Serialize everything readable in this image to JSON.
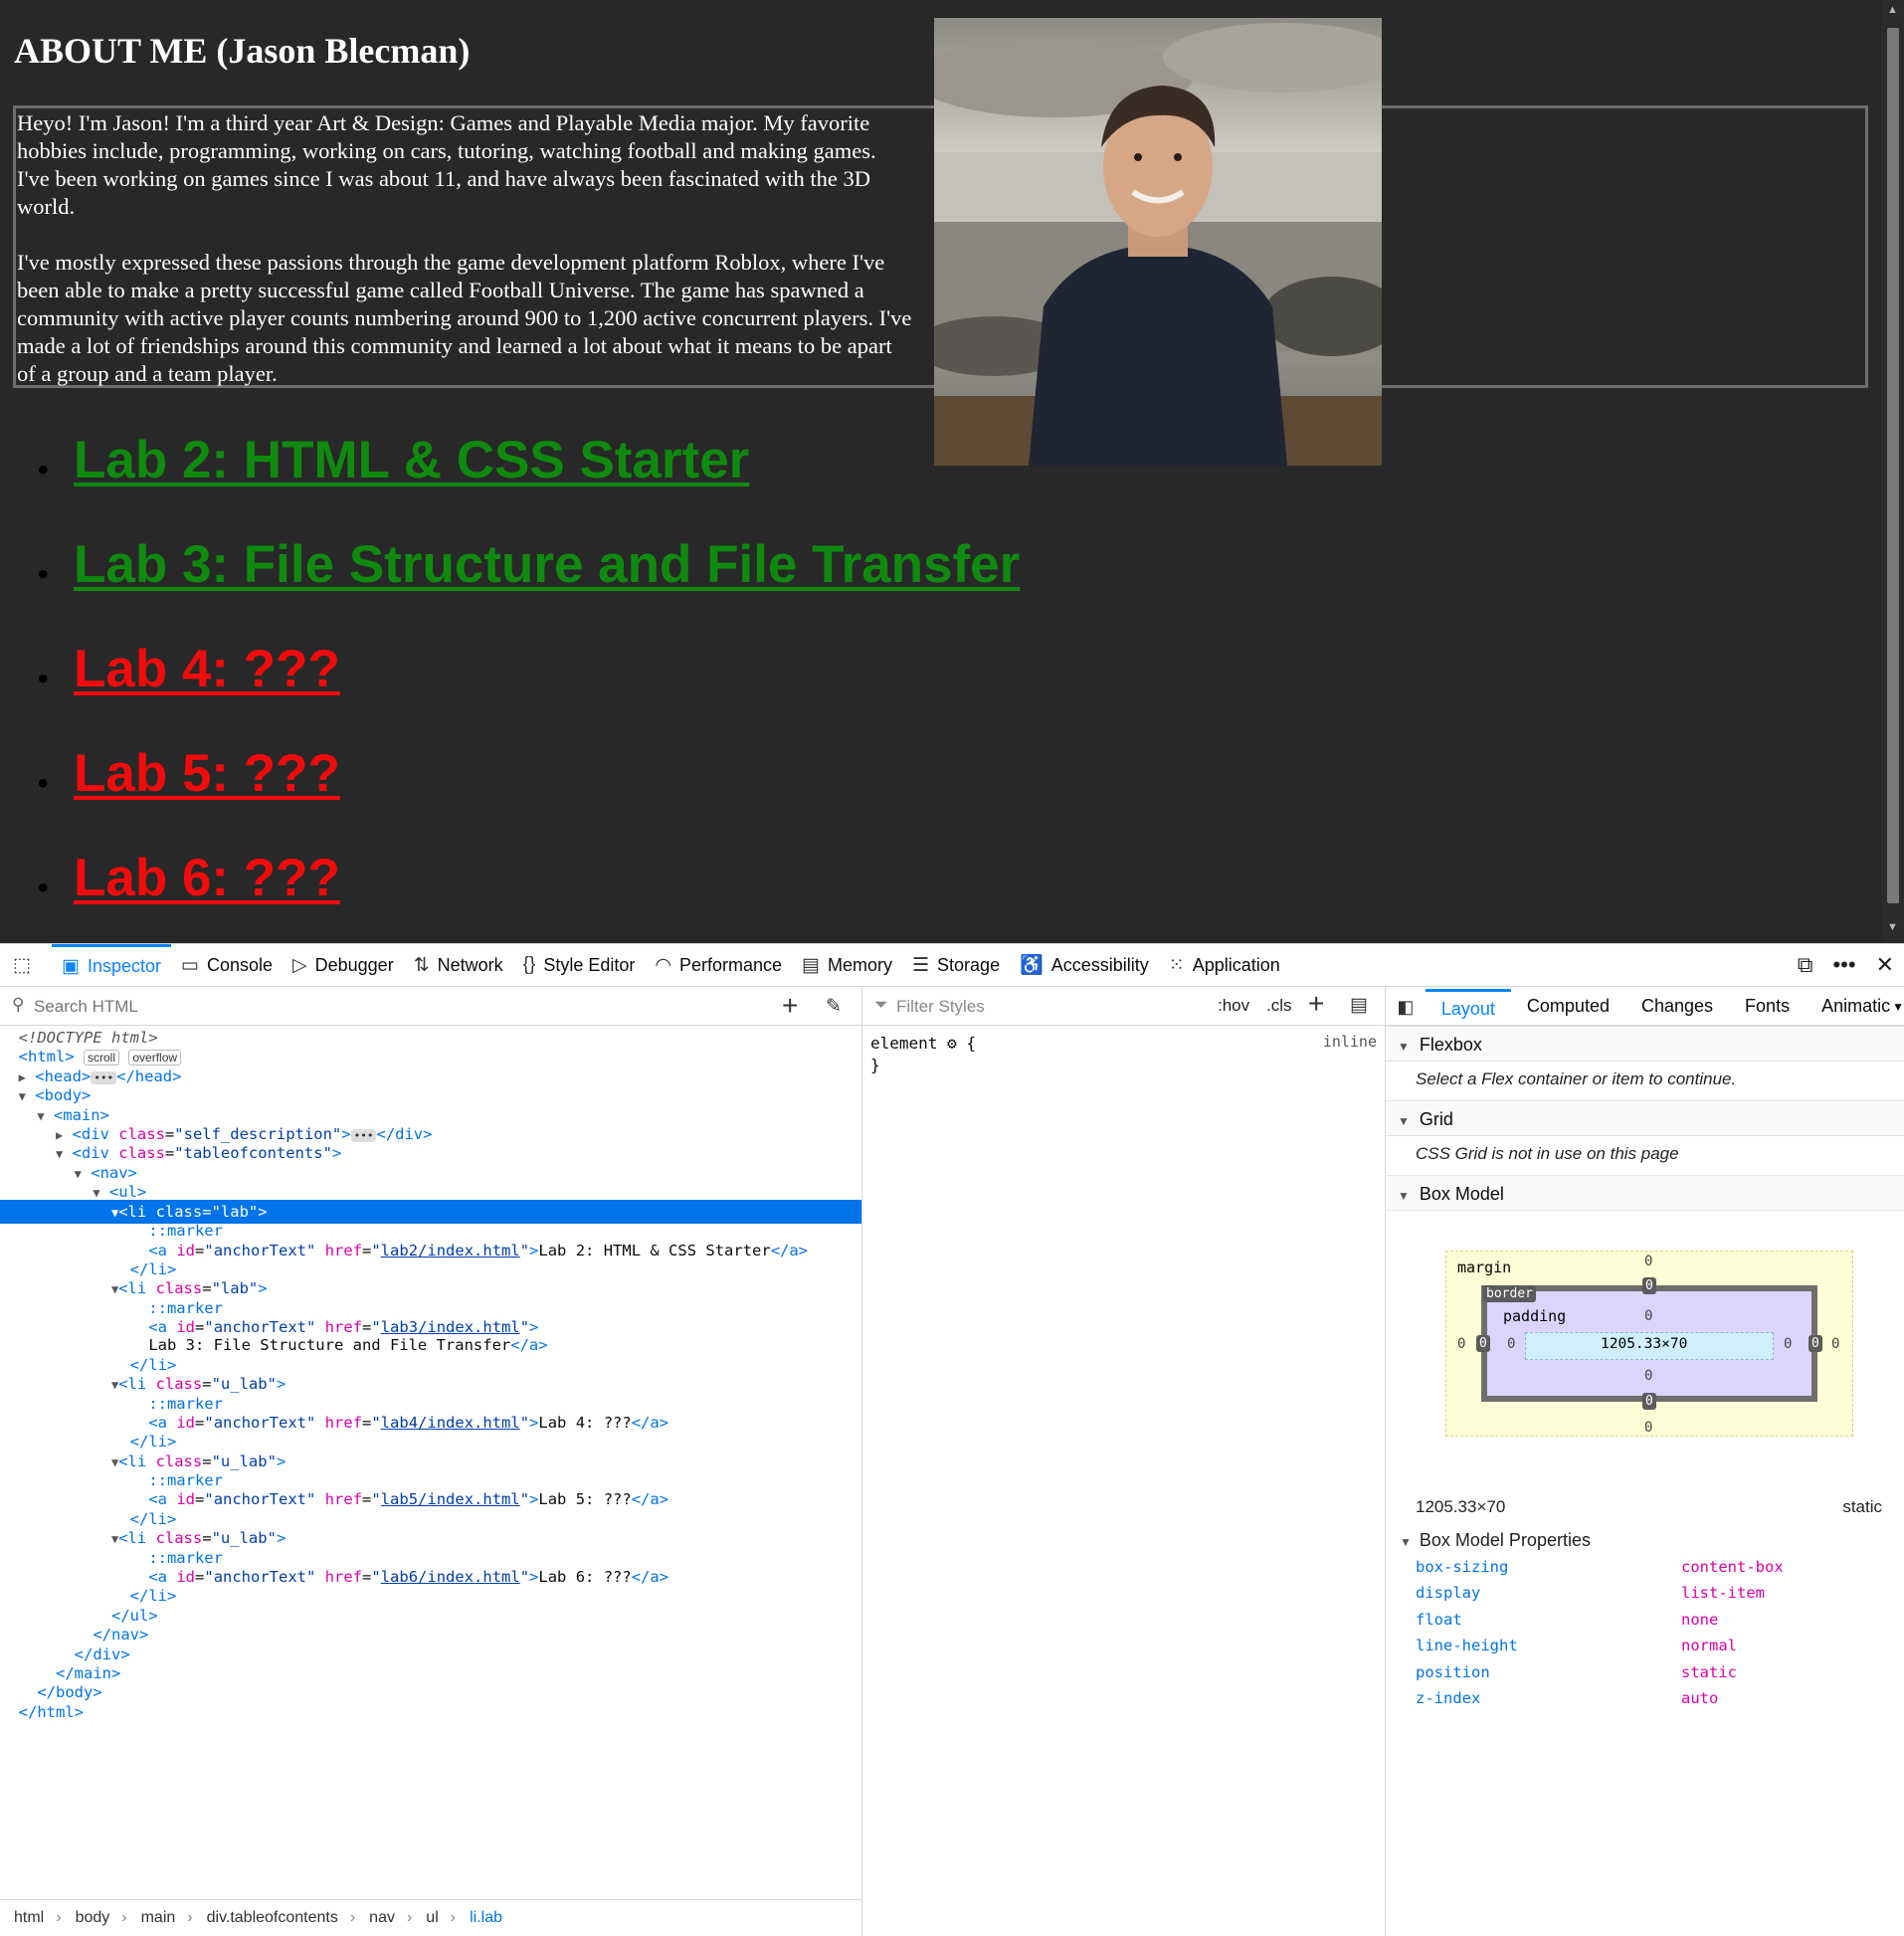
{
  "page": {
    "title": "ABOUT ME (Jason Blecman)",
    "paragraph1": "Heyo! I'm Jason! I'm a third year Art & Design: Games and Playable Media major. My favorite hobbies include, programming, working on cars, tutoring, watching football and making games. I've been working on games since I was about 11, and have always been fascinated with the 3D world.",
    "paragraph2": "I've mostly expressed these passions through the game development platform Roblox, where I've been able to make a pretty successful game called Football Universe. The game has spawned a community with active player counts numbering around 900 to 1,200 active concurrent players. I've made a lot of friendships around this community and learned a lot about what it means to be apart of a group and a team player.",
    "labs": [
      {
        "label": "Lab 2: HTML & CSS Starter",
        "status": "lab"
      },
      {
        "label": "Lab 3: File Structure and File Transfer",
        "status": "lab"
      },
      {
        "label": "Lab 4: ???",
        "status": "u_lab"
      },
      {
        "label": "Lab 5: ???",
        "status": "u_lab"
      },
      {
        "label": "Lab 6: ???",
        "status": "u_lab"
      }
    ],
    "colors": {
      "background": "#282828",
      "complete_link": "#0f8a0f",
      "upcoming_link": "#f00c0c"
    }
  },
  "devtools": {
    "tabs": [
      {
        "label": "Inspector",
        "icon": "inspector-icon",
        "active": true
      },
      {
        "label": "Console",
        "icon": "console-icon"
      },
      {
        "label": "Debugger",
        "icon": "debugger-icon"
      },
      {
        "label": "Network",
        "icon": "network-icon"
      },
      {
        "label": "Style Editor",
        "icon": "style-editor-icon"
      },
      {
        "label": "Performance",
        "icon": "performance-icon"
      },
      {
        "label": "Memory",
        "icon": "memory-icon"
      },
      {
        "label": "Storage",
        "icon": "storage-icon"
      },
      {
        "label": "Accessibility",
        "icon": "accessibility-icon"
      },
      {
        "label": "Application",
        "icon": "application-icon"
      }
    ],
    "search_placeholder": "Search HTML",
    "filter_placeholder": "Filter Styles",
    "hov": ":hov",
    "cls": ".cls",
    "rule_selector": "element",
    "rule_source": "inline",
    "tree": {
      "doctype": "<!DOCTYPE html>",
      "html_badge_scroll": "scroll",
      "html_badge_overflow": "overflow",
      "self_description": "self_description",
      "tableofcontents": "tableofcontents",
      "marker": "::marker",
      "anchor_id": "anchorText",
      "items": [
        {
          "class": "lab",
          "href": "lab2/index.html",
          "text": "Lab 2: HTML & CSS Starter"
        },
        {
          "class": "lab",
          "href": "lab3/index.html",
          "text": "Lab 3: File Structure and File Transfer"
        },
        {
          "class": "u_lab",
          "href": "lab4/index.html",
          "text": "Lab 4: ???"
        },
        {
          "class": "u_lab",
          "href": "lab5/index.html",
          "text": "Lab 5: ???"
        },
        {
          "class": "u_lab",
          "href": "lab6/index.html",
          "text": "Lab 6: ???"
        }
      ]
    },
    "breadcrumbs": [
      "html",
      "body",
      "main",
      "div.tableofcontents",
      "nav",
      "ul",
      "li.lab"
    ],
    "sidebar": {
      "tabs": [
        "Layout",
        "Computed",
        "Changes",
        "Fonts",
        "Animatic"
      ],
      "flexbox_title": "Flexbox",
      "flexbox_msg": "Select a Flex container or item to continue.",
      "grid_title": "Grid",
      "grid_msg": "CSS Grid is not in use on this page",
      "boxmodel_title": "Box Model",
      "margin_label": "margin",
      "border_label": "border",
      "padding_label": "padding",
      "content_size": "1205.33×70",
      "zero": "0",
      "size_readout": "1205.33×70",
      "position_readout": "static",
      "props_title": "Box Model Properties",
      "props": [
        {
          "name": "box-sizing",
          "value": "content-box"
        },
        {
          "name": "display",
          "value": "list-item"
        },
        {
          "name": "float",
          "value": "none"
        },
        {
          "name": "line-height",
          "value": "normal"
        },
        {
          "name": "position",
          "value": "static"
        },
        {
          "name": "z-index",
          "value": "auto"
        }
      ]
    }
  }
}
